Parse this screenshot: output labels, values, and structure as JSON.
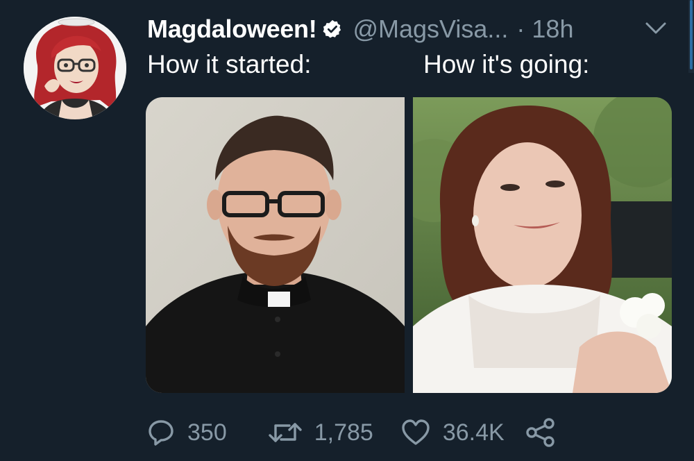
{
  "tweet": {
    "display_name": "Magdaloween!",
    "handle": "@MagsVisa...",
    "separator": "·",
    "time": "18h",
    "line_left": "How it started:",
    "line_right": "How it's going:"
  },
  "stats": {
    "replies": "350",
    "retweets": "1,785",
    "likes": "36.4K"
  },
  "icons": {
    "verified": "verified-badge-icon",
    "menu": "chevron-down-icon",
    "reply": "reply-icon",
    "retweet": "retweet-icon",
    "like": "heart-icon",
    "share": "share-icon"
  },
  "colors": {
    "background": "#15202b",
    "text_primary": "#ffffff",
    "text_secondary": "#8899a6"
  }
}
